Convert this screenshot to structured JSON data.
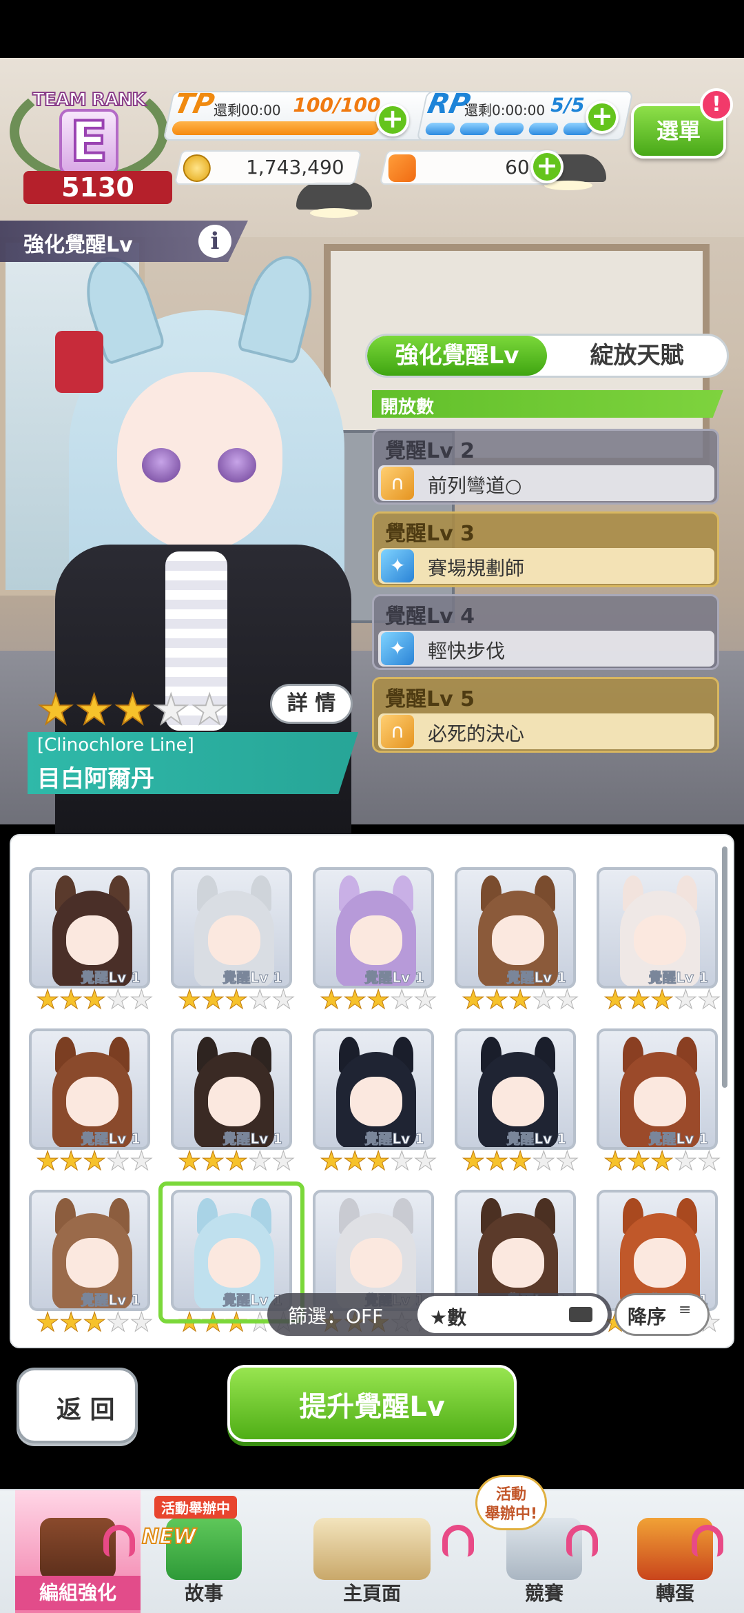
{
  "hud": {
    "rank_title": "TEAM RANK",
    "rank_letter": "E",
    "rank_score": "5130",
    "tp_label": "TP",
    "tp_timer": "還剩00:00",
    "tp_value": "100/100",
    "rp_label": "RP",
    "rp_timer": "還剩0:00:00",
    "rp_value": "5/5",
    "menu_label": "選單",
    "menu_badge": "!",
    "money": "1,743,490",
    "carrots": "608",
    "tp_fill_fraction": 1.0,
    "rp_pills_filled": 5
  },
  "section": {
    "title": "強化覺醒Lv",
    "info": "i"
  },
  "tabs": [
    {
      "label": "強化覺醒Lv",
      "active": true
    },
    {
      "label": "綻放天賦",
      "active": false
    }
  ],
  "open_count_label": "開放數",
  "awakening": [
    {
      "level": "覺醒Lv 2",
      "skill": "前列彎道○",
      "icon": "horseshoe-skill-icon"
    },
    {
      "level": "覺醒Lv 3",
      "skill": "賽場規劃師",
      "icon": "sparkle-skill-icon"
    },
    {
      "level": "覺醒Lv 4",
      "skill": "輕快步伐",
      "icon": "sparkle-skill-icon"
    },
    {
      "level": "覺醒Lv 5",
      "skill": "必死的決心",
      "icon": "horseshoe-skill-icon"
    }
  ],
  "character": {
    "stars": 3,
    "max_stars": 5,
    "detail_label": "詳 情",
    "outfit": "[Clinochlore Line]",
    "name": "目白阿爾丹"
  },
  "roster": {
    "lv_label": "覺醒Lv 1",
    "cards": [
      {
        "hair": "#4a2f28",
        "ear": "#5a3a2c"
      },
      {
        "hair": "#d9dde3",
        "ear": "#cfd4da"
      },
      {
        "hair": "#b79ad9",
        "ear": "#c9b0e6"
      },
      {
        "hair": "#8b5a3a",
        "ear": "#7a4c2e"
      },
      {
        "hair": "#efe8e6",
        "ear": "#f2e3dd"
      },
      {
        "hair": "#8a4a2c",
        "ear": "#7b3e22"
      },
      {
        "hair": "#3a2a24",
        "ear": "#2e2420"
      },
      {
        "hair": "#1f2433",
        "ear": "#1a1e2b"
      },
      {
        "hair": "#1f2433",
        "ear": "#1a1e2b"
      },
      {
        "hair": "#9b4a2a",
        "ear": "#8a3f22"
      },
      {
        "hair": "#9a6a4a",
        "ear": "#8c5d3e"
      },
      {
        "hair": "#bfe0ee",
        "ear": "#a9d3e6"
      },
      {
        "hair": "#dfe0e4",
        "ear": "#c9cbd2"
      },
      {
        "hair": "#5b3a2a",
        "ear": "#4b3022"
      },
      {
        "hair": "#c0582a",
        "ear": "#a9491f"
      }
    ],
    "card_stars": 3
  },
  "filter": {
    "label": "篩選：OFF",
    "sort_label": "★數",
    "order_label": "降序"
  },
  "actions": {
    "back_label": "返 回",
    "primary_label": "提升覺醒Lv"
  },
  "nav": {
    "items": [
      {
        "label": "編組強化",
        "active": true
      },
      {
        "label": "故事",
        "active": false
      },
      {
        "label": "主頁面",
        "active": false
      },
      {
        "label": "競賽",
        "active": false
      },
      {
        "label": "轉蛋",
        "active": false
      }
    ],
    "event_tag": "活動舉辦中",
    "new_tag": "NEW",
    "event_bubble_line1": "活動",
    "event_bubble_line2": "舉辦中!"
  }
}
